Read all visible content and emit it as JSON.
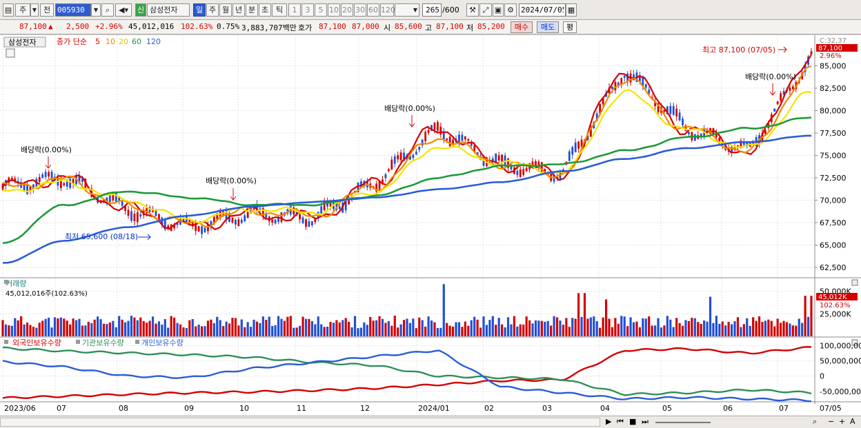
{
  "toolbar": {
    "market_type": "주",
    "prev_label": "전",
    "stock_code": "005930",
    "stock_badge": "신",
    "stock_name": "삼성전자",
    "periods": [
      "일",
      "주",
      "월",
      "년",
      "분",
      "초",
      "틱"
    ],
    "active_period": "일",
    "intervals": [
      "1",
      "3",
      "5",
      "10",
      "20",
      "30",
      "60",
      "120"
    ],
    "count": "265",
    "count_total": "/600",
    "date": "2024/07/05"
  },
  "quote": {
    "price": "87,100",
    "change": "2,500",
    "change_pct": "+2.96%",
    "volume": "45,012,016",
    "volume_ratio": "102.63%",
    "turnover": "0.75%",
    "amount": "3,883,707백만",
    "bid_label": "호가",
    "bid": "87,100",
    "ask": "87,000",
    "open_label": "시",
    "open": "85,600",
    "high_label": "고",
    "high": "87,100",
    "low_label": "저",
    "low": "85,200",
    "buy_label": "매수",
    "sell_label": "매도",
    "eval_label": "평"
  },
  "price_panel": {
    "title": "삼성전자",
    "legend_close": "종가 단순",
    "ma_labels": [
      "5",
      "10",
      "20",
      "60",
      "120"
    ],
    "ma_colors": [
      "#d40000",
      "#f08a00",
      "#f5e400",
      "#1f9a3a",
      "#2a5cd8"
    ],
    "current_tag": "87,100",
    "pct_tag": "2.96%",
    "top_right_label": "C:32,37",
    "high_note": "최고 87,100 (07/05)",
    "low_note": "최저 65,600 (08/18)",
    "dividend_label": "배당락(0.00%)",
    "y_ticks": [
      "85,000",
      "82,500",
      "80,000",
      "77,500",
      "75,000",
      "72,500",
      "70,000",
      "67,500",
      "65,000",
      "62,500"
    ]
  },
  "volume_panel": {
    "title": "거래량",
    "value_text": "45,012,016주(102.63%)",
    "tag_value": "45,012K",
    "tag_pct": "102.63%",
    "y_ticks": [
      "50,000K",
      "25,000K"
    ]
  },
  "holding_panel": {
    "legend": [
      "외국인보유수량",
      "기관보유수량",
      "개인보유수량"
    ],
    "legend_colors": [
      "#d40000",
      "#2f8f5a",
      "#2a5cd8"
    ],
    "y_ticks": [
      "100,000,000",
      "50,000,000",
      "0",
      "-50,000,000"
    ]
  },
  "x_axis": {
    "labels": [
      "2023/06",
      "07",
      "08",
      "09",
      "10",
      "11",
      "12",
      "2024/01",
      "02",
      "03",
      "04",
      "05",
      "06",
      "07"
    ],
    "right_label": "07/05"
  },
  "chart_data": {
    "type": "line",
    "title": "",
    "xlabel": "",
    "ylabel": "",
    "x": [
      "2023/06",
      "07",
      "08",
      "09",
      "10",
      "11",
      "12",
      "2024/01",
      "02",
      "03",
      "04",
      "05",
      "06",
      "07"
    ],
    "ylim": [
      61500,
      87800
    ],
    "series": [
      {
        "name": "5",
        "values": [
          71500,
          72500,
          69000,
          67000,
          68500,
          68000,
          72000,
          78000,
          74000,
          73000,
          84500,
          78000,
          75500,
          86000
        ]
      },
      {
        "name": "10",
        "values": [
          71400,
          72300,
          69300,
          67300,
          68800,
          68300,
          71600,
          77000,
          74100,
          73000,
          83500,
          78000,
          75500,
          84500
        ]
      },
      {
        "name": "20",
        "values": [
          71000,
          72000,
          70000,
          67800,
          69000,
          68700,
          71000,
          76000,
          74200,
          73100,
          82000,
          77800,
          75800,
          82000
        ]
      },
      {
        "name": "60",
        "values": [
          65200,
          69500,
          71000,
          70300,
          69500,
          69500,
          70500,
          72500,
          73800,
          74000,
          75500,
          77000,
          78000,
          79200
        ]
      },
      {
        "name": "120",
        "values": [
          63000,
          65500,
          67000,
          68300,
          69300,
          69800,
          70300,
          71200,
          72000,
          73200,
          74600,
          75800,
          76500,
          77200
        ]
      }
    ]
  }
}
